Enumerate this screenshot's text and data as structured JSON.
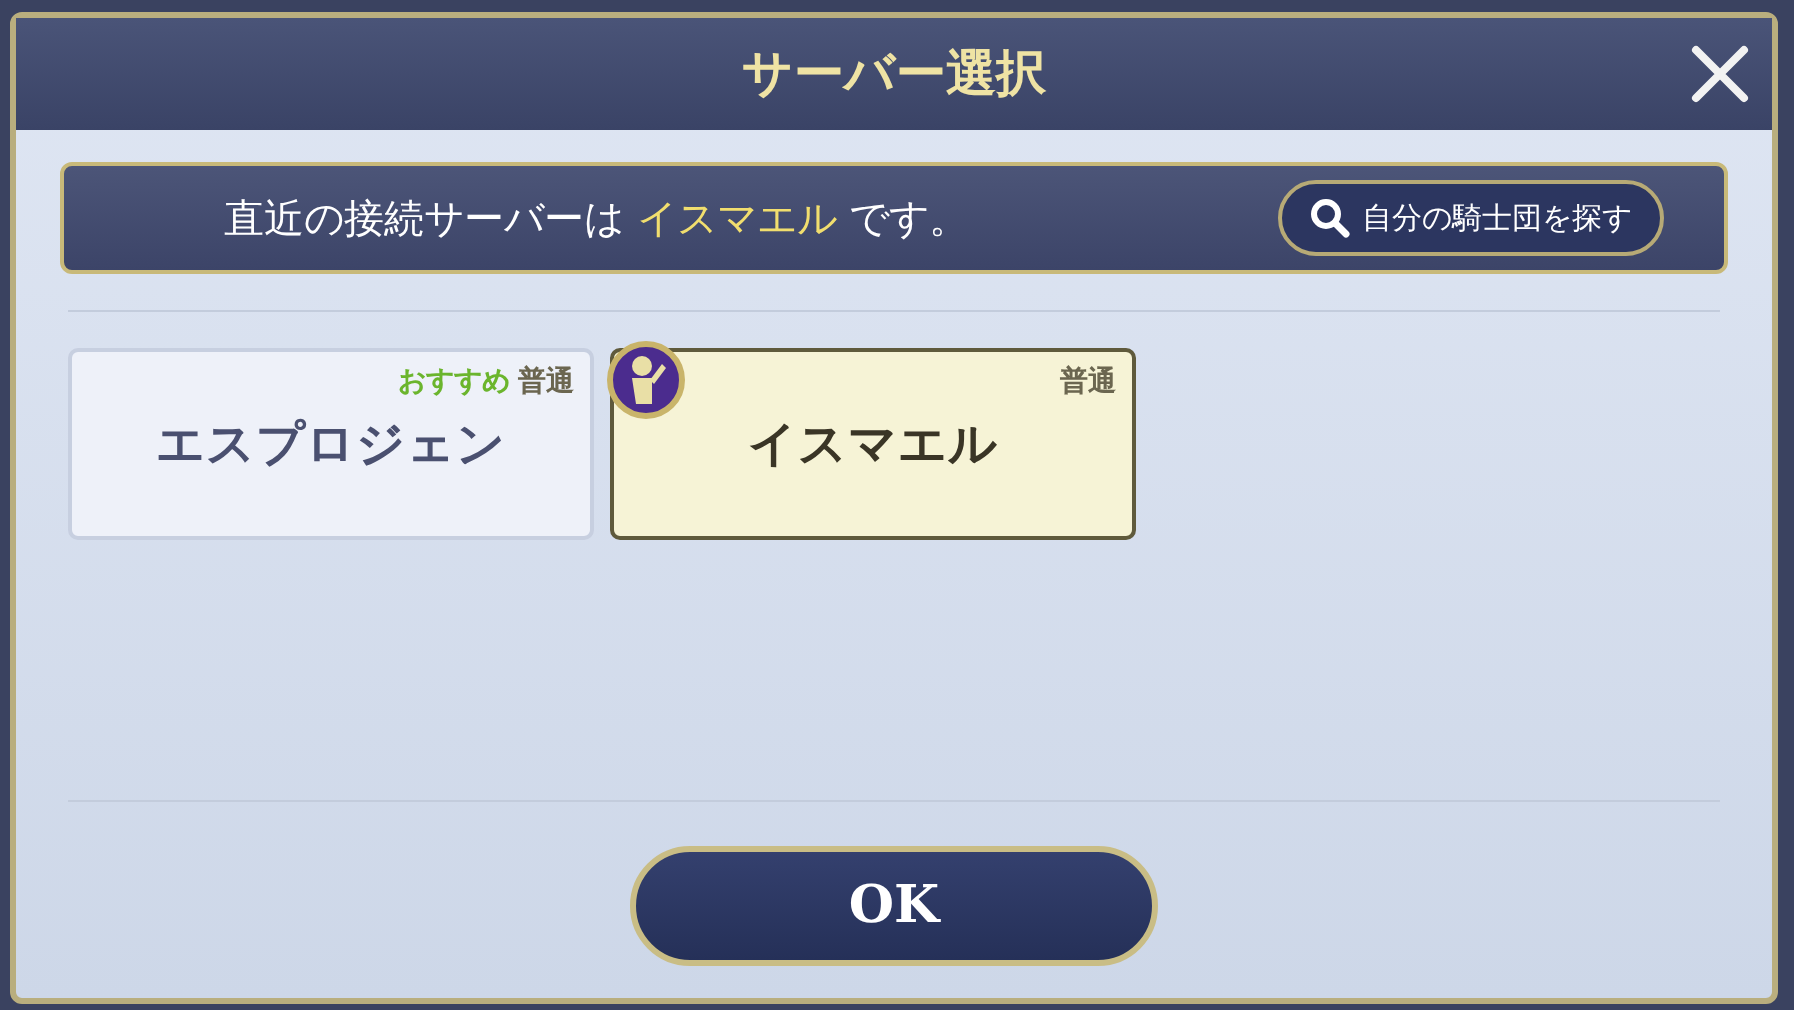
{
  "window": {
    "title": "サーバー選択"
  },
  "notice": {
    "prefix": "直近の接続サーバーは",
    "server": "イスマエル",
    "suffix": "です。"
  },
  "search_button": {
    "label": "自分の騎士団を探す"
  },
  "servers": [
    {
      "recommended_label": "おすすめ",
      "status": "普通",
      "name": "エスプロジェン",
      "selected": false,
      "recent": false
    },
    {
      "status": "普通",
      "name": "イスマエル",
      "selected": true,
      "recent": true
    }
  ],
  "ok_button": {
    "label": "OK"
  }
}
